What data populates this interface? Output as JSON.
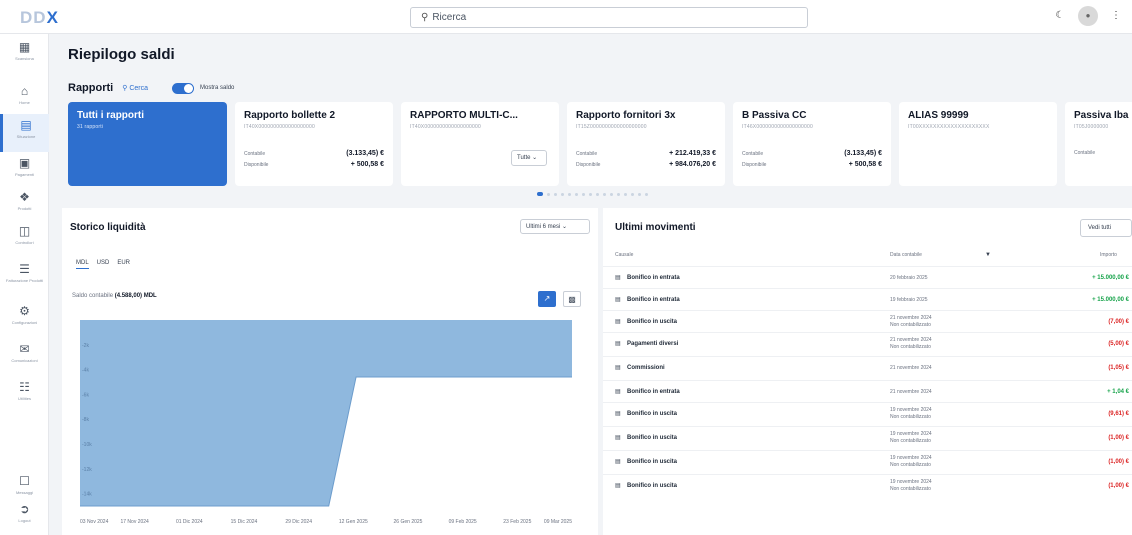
{
  "topbar": {
    "logo_light": "DD",
    "logo_accent": "X",
    "search_placeholder": "Ricerca",
    "icons": [
      "moon-icon",
      "avatar",
      "more-icon"
    ]
  },
  "sidebar": {
    "items": [
      {
        "label": "Scansiona",
        "icon": "scan-icon"
      },
      {
        "label": "Home",
        "icon": "home-icon"
      },
      {
        "label": "Situazione",
        "icon": "situation-icon"
      },
      {
        "label": "Pagamenti",
        "icon": "payments-icon"
      },
      {
        "label": "Prodotti",
        "icon": "products-icon"
      },
      {
        "label": "Controllori",
        "icon": "controllers-icon"
      },
      {
        "label": "Fatturazione Prodotti",
        "icon": "billing-icon"
      },
      {
        "label": "Configurazioni",
        "icon": "settings-icon"
      },
      {
        "label": "Comunicazioni",
        "icon": "communications-icon"
      },
      {
        "label": "Utilities",
        "icon": "utilities-icon"
      },
      {
        "label": "Messaggi",
        "icon": "messages-icon"
      },
      {
        "label": "Logout",
        "icon": "logout-icon"
      }
    ]
  },
  "page": {
    "title": "Riepilogo saldi",
    "rapporti_label": "Rapporti",
    "cerca_label": "Cerca",
    "toggle_label": "Mostra saldo"
  },
  "cards": [
    {
      "title": "Tutti i rapporti",
      "sub": "31 rapporti"
    },
    {
      "title": "Rapporto bollette 2",
      "sub": "IT40X0000000000000000000",
      "k1": "Contabile",
      "v1": "(3.133,45) €",
      "k2": "Disponibile",
      "v2": "+ 500,58 €"
    },
    {
      "title": "RAPPORTO MULTI-C...",
      "sub": "IT40X0000000000000000000",
      "select": "Tutte"
    },
    {
      "title": "Rapporto fornitori 3x",
      "sub": "IT15Z0000000000000000000",
      "k1": "Contabile",
      "v1": "+ 212.419,33 €",
      "k2": "Disponibile",
      "v2": "+ 984.076,20 €"
    },
    {
      "title": "B Passiva CC",
      "sub": "IT46X0000000000000000000",
      "k1": "Contabile",
      "v1": "(3.133,45) €",
      "k2": "Disponibile",
      "v2": "+ 500,58 €"
    },
    {
      "title": "ALIAS 99999",
      "sub": "IT00XXXXXXXXXXXXXXXXXXXX"
    },
    {
      "title": "Passiva Iba",
      "sub": "IT05J0000000",
      "k1": "Contabile",
      "v1": ""
    }
  ],
  "liquidity": {
    "title": "Storico liquidità",
    "period": "Ultimi 6 mesi",
    "currencies": [
      "MDL",
      "USD",
      "EUR"
    ],
    "saldo_label": "Saldo contabile",
    "saldo_value": "(4.588,00) MDL"
  },
  "chart_data": {
    "type": "area",
    "x": [
      "03 Nov 2024",
      "17 Nov 2024",
      "01 Dic 2024",
      "15 Dic 2024",
      "29 Dic 2024",
      "12 Gen 2025",
      "26 Gen 2025",
      "09 Feb 2025",
      "23 Feb 2025",
      "09 Mar 2025"
    ],
    "y_tick_labels": [
      "-2k",
      "-4k",
      "-6k",
      "-8k",
      "-10k",
      "-12k",
      "-14k"
    ],
    "points": [
      {
        "x": 0,
        "y": -15000
      },
      {
        "x": 4.55,
        "y": -15000
      },
      {
        "x": 5.05,
        "y": -4600
      },
      {
        "x": 9,
        "y": -4600
      }
    ],
    "ylim": [
      -15000,
      0
    ],
    "color": "#8fb8de",
    "grid": false,
    "legend": "none"
  },
  "movements": {
    "title": "Ultimi movimenti",
    "view_all": "Vedi tutti",
    "headers": {
      "causale": "Causale",
      "data": "Data contabile",
      "importo": "Importo"
    },
    "rows": [
      {
        "label": "Bonifico in entrata",
        "date": "20 febbraio 2025",
        "date2": "",
        "amount": "+ 15.000,00 €",
        "sign": "pos"
      },
      {
        "label": "Bonifico in entrata",
        "date": "19 febbraio 2025",
        "date2": "",
        "amount": "+ 15.000,00 €",
        "sign": "pos"
      },
      {
        "label": "Bonifico in uscita",
        "date": "21 novembre 2024",
        "date2": "Non contabilizzato",
        "amount": "(7,00) €",
        "sign": "neg"
      },
      {
        "label": "Pagamenti diversi",
        "date": "21 novembre 2024",
        "date2": "Non contabilizzato",
        "amount": "(5,00) €",
        "sign": "neg"
      },
      {
        "label": "Commissioni",
        "date": "21 novembre 2024",
        "date2": "",
        "amount": "(1,05) €",
        "sign": "neg"
      },
      {
        "label": "Bonifico in entrata",
        "date": "21 novembre 2024",
        "date2": "",
        "amount": "+ 1,04 €",
        "sign": "pos"
      },
      {
        "label": "Bonifico in uscita",
        "date": "19 novembre 2024",
        "date2": "Non contabilizzato",
        "amount": "(9,61) €",
        "sign": "neg"
      },
      {
        "label": "Bonifico in uscita",
        "date": "19 novembre 2024",
        "date2": "Non contabilizzato",
        "amount": "(1,00) €",
        "sign": "neg"
      },
      {
        "label": "Bonifico in uscita",
        "date": "19 novembre 2024",
        "date2": "Non contabilizzato",
        "amount": "(1,00) €",
        "sign": "neg"
      },
      {
        "label": "Bonifico in uscita",
        "date": "19 novembre 2024",
        "date2": "Non contabilizzato",
        "amount": "(1,00) €",
        "sign": "neg"
      }
    ]
  },
  "colors": {
    "accent": "#2e6fce",
    "positive": "#16a34a",
    "negative": "#dc2626"
  }
}
